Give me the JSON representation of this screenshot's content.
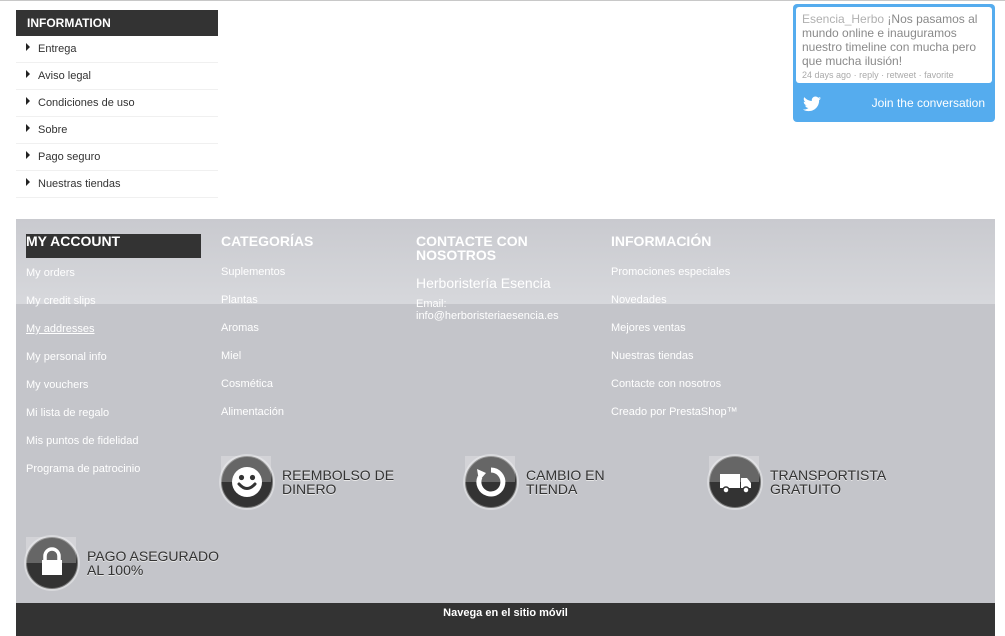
{
  "info_block": {
    "title": "INFORMATION",
    "items": [
      "Entrega",
      "Aviso legal",
      "Condiciones de uso",
      "Sobre",
      "Pago seguro",
      "Nuestras tiendas"
    ]
  },
  "twitter": {
    "user": "Esencia_Herbo",
    "text": "¡Nos pasamos al mundo online e inauguramos nuestro timeline con mucha pero que mucha ilusión!",
    "time": "24 days ago",
    "reply": "reply",
    "retweet": "retweet",
    "favorite": "favorite",
    "separator": "·",
    "join": "Join the conversation",
    "icon": "twitter-bird-icon",
    "color": "#55acee"
  },
  "footer": {
    "account": {
      "title": "MY ACCOUNT",
      "links": [
        "My orders",
        "My credit slips",
        "My addresses",
        "My personal info",
        "My vouchers",
        "Mi lista de regalo",
        "Mis puntos de fidelidad",
        "Programa de patrocinio"
      ]
    },
    "categories": {
      "title": "CATEGORÍAS",
      "links": [
        "Suplementos",
        "Plantas",
        "Aromas",
        "Miel",
        "Cosmética",
        "Alimentación"
      ]
    },
    "contact": {
      "title": "CONTACTE CON NOSOTROS",
      "company": "Herboristería Esencia",
      "email_label": "Email:",
      "email": "info@herboristeriaesencia.es"
    },
    "information": {
      "title": "INFORMACIÓN",
      "links": [
        "Promociones especiales",
        "Novedades",
        "Mejores ventas",
        "Nuestras tiendas",
        "Contacte con nosotros",
        "Creado por PrestaShop™"
      ]
    },
    "reassurance": [
      {
        "label": "REEMBOLSO DE DINERO",
        "icon": "smiley-icon"
      },
      {
        "label": "CAMBIO EN TIENDA",
        "icon": "refresh-icon"
      },
      {
        "label": "TRANSPORTISTA GRATUITO",
        "icon": "truck-icon"
      },
      {
        "label": "PAGO ASEGURADO AL 100%",
        "icon": "lock-icon"
      }
    ]
  },
  "mobile": {
    "label": "Navega en el sitio móvil"
  },
  "colors": {
    "dark": "#333333",
    "footer_bg": "#c4c5ca",
    "twitter": "#55acee"
  }
}
